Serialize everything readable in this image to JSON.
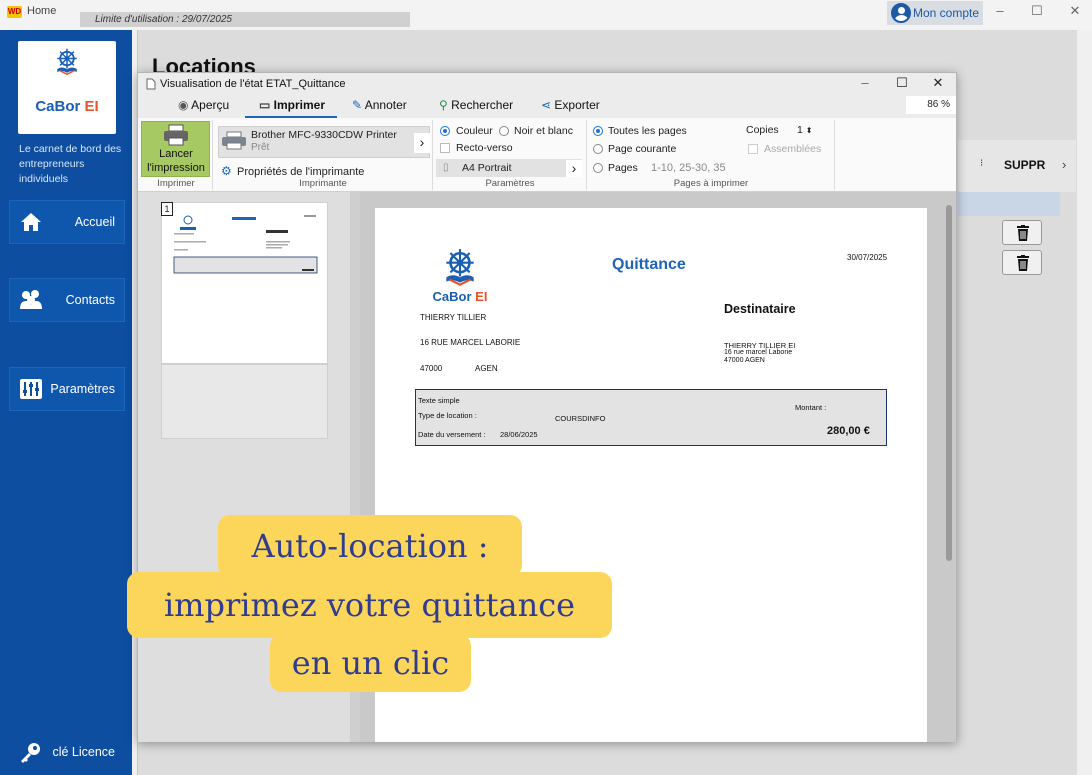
{
  "window": {
    "app_label": "Home",
    "logo_text": "WD",
    "limit_text": "Limite d'utilisation : 29/07/2025",
    "account_label": "Mon compte",
    "minimize": "–",
    "maximize": "☐",
    "close": "✕"
  },
  "sidebar": {
    "logo_main": "CaBor",
    "logo_accent": "EI",
    "tagline": "Le carnet de bord des entrepreneurs individuels",
    "items": [
      {
        "label": "Accueil",
        "icon": "home-icon"
      },
      {
        "label": "Contacts",
        "icon": "contacts-icon"
      },
      {
        "label": "Paramètres",
        "icon": "settings-icon"
      }
    ],
    "license_label": "clé Licence"
  },
  "main": {
    "title": "Locations",
    "column_header": "SUPPR",
    "sort_glyph": "⁝",
    "chevron": "›"
  },
  "dialog": {
    "title": "Visualisation de l'état ETAT_Quittance",
    "zoom": "86 %",
    "tabs": [
      {
        "label": "Aperçu",
        "icon": "eye-icon"
      },
      {
        "label": "Imprimer",
        "icon": "printer-icon"
      },
      {
        "label": "Annoter",
        "icon": "pen-icon"
      },
      {
        "label": "Rechercher",
        "icon": "search-icon"
      },
      {
        "label": "Exporter",
        "icon": "share-icon"
      }
    ],
    "active_tab": "Imprimer",
    "print_group": {
      "launch_label": "Lancer l'impression",
      "group_label": "Imprimer"
    },
    "printer_group": {
      "printer_name": "Brother MFC-9330CDW Printer",
      "printer_status": "Prêt",
      "properties_label": "Propriétés de l'imprimante",
      "group_label": "Imprimante"
    },
    "params_group": {
      "color_label": "Couleur",
      "bw_label": "Noir et blanc",
      "duplex_label": "Recto-verso",
      "format_label": "A4 Portrait",
      "group_label": "Paramètres",
      "selected_color_mode": "Couleur"
    },
    "pages_group": {
      "all_pages": "Toutes les pages",
      "current_page": "Page courante",
      "pages": "Pages",
      "range_placeholder": "1-10, 25-30, 35",
      "copies_label": "Copies",
      "copies_value": "1",
      "assembled_label": "Assemblées",
      "group_label": "Pages à imprimer",
      "selected": "Toutes les pages"
    },
    "thumbnail_number": "1"
  },
  "document": {
    "title": "Quittance",
    "date": "30/07/2025",
    "sender": {
      "name": "THIERRY TILLIER",
      "address": "16 RUE MARCEL LABORIE",
      "zip": "47000",
      "city": "AGEN"
    },
    "recipient_title": "Destinataire",
    "recipient": {
      "name": "THIERRY TILLIER EI",
      "address": "16 rue marcel Laborie",
      "city": "47000 AGEN"
    },
    "type": "Texte simple",
    "location_label": "Type de location :",
    "location_value": "COURSDINFO",
    "payment_label": "Date du versement :",
    "payment_date": "28/06/2025",
    "amount_label": "Montant :",
    "amount": "280,00 €"
  },
  "promo": {
    "line1": "Auto-location :",
    "line2": "imprimez votre quittance",
    "line3": "en un clic"
  },
  "colors": {
    "sidebar": "#0d4ea1",
    "accent": "#1d64bb",
    "logo_accent": "#e9532b",
    "launch_button": "#a6c964",
    "promo_bg": "#fcd55b",
    "promo_text": "#2f3c8f"
  }
}
